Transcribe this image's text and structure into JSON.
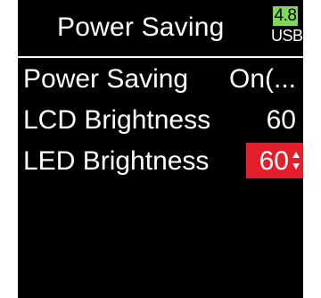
{
  "header": {
    "title": "Power Saving",
    "battery": {
      "value": "4.8",
      "source": "USB",
      "color": "#7ed957"
    }
  },
  "menu": {
    "items": [
      {
        "label": "Power Saving",
        "value": "On(..."
      },
      {
        "label": "LCD Brightness",
        "value": "60"
      },
      {
        "label": "LED Brightness",
        "value": "60",
        "selected": true,
        "highlight_color": "#e41e2b",
        "icon": "up-down-arrows-icon"
      }
    ]
  }
}
